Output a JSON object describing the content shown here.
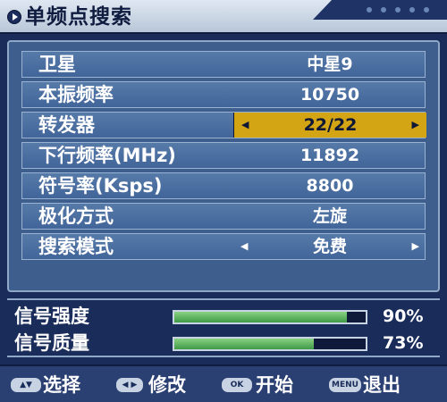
{
  "title": "单频点搜索",
  "params": [
    {
      "label": "卫星",
      "value": "中星9",
      "selected": false,
      "arrows": false
    },
    {
      "label": "本振频率",
      "value": "10750",
      "selected": false,
      "arrows": false
    },
    {
      "label": "转发器",
      "value": "22/22",
      "selected": true,
      "arrows": true
    },
    {
      "label": "下行频率(MHz)",
      "value": "11892",
      "selected": false,
      "arrows": false
    },
    {
      "label": "符号率(Ksps)",
      "value": "8800",
      "selected": false,
      "arrows": false
    },
    {
      "label": "极化方式",
      "value": "左旋",
      "selected": false,
      "arrows": false
    },
    {
      "label": "搜索模式",
      "value": "免费",
      "selected": false,
      "arrows": true
    }
  ],
  "signal": {
    "strength_label": "信号强度",
    "strength_value": 90,
    "strength_text": "90%",
    "quality_label": "信号质量",
    "quality_value": 73,
    "quality_text": "73%"
  },
  "help": [
    {
      "key": "▲▼",
      "text": "选择"
    },
    {
      "key": "◀ ▶",
      "text": "修改"
    },
    {
      "key": "OK",
      "text": "开始"
    },
    {
      "key": "MENU",
      "text": "退出"
    }
  ],
  "colors": {
    "selected_bg": "#d3a414",
    "signal_fill": "#5db35c",
    "panel_bg": "#3e5f8e"
  }
}
